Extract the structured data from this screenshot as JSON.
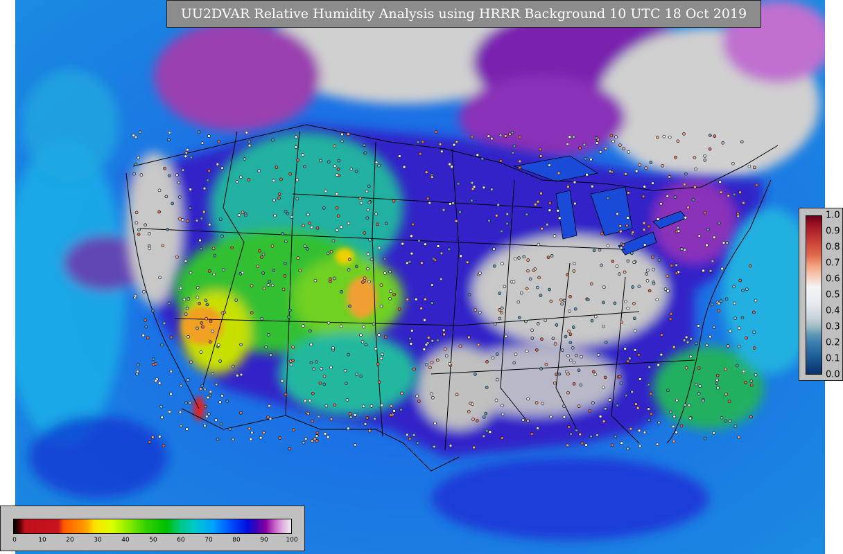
{
  "title": "UU2DVAR Relative Humidity Analysis using HRRR Background 10 UTC 18 Oct 2019",
  "rh_colorbar": {
    "ticks": [
      "0",
      "10",
      "20",
      "30",
      "40",
      "50",
      "60",
      "70",
      "80",
      "90",
      "100"
    ]
  },
  "fraction_colorbar": {
    "ticks": [
      "1.0",
      "0.9",
      "0.8",
      "0.7",
      "0.6",
      "0.5",
      "0.4",
      "0.3",
      "0.2",
      "0.1",
      "0.0"
    ]
  },
  "colors": {
    "ocean": "#1e6fe0",
    "land_moist": "#3c28c8",
    "saturated": "#c8c8c8",
    "dry_green": "#30c030",
    "very_dry": "#f0a020",
    "title_bg": "#8c8c8c",
    "legend_bg": "#c0c0c0"
  }
}
